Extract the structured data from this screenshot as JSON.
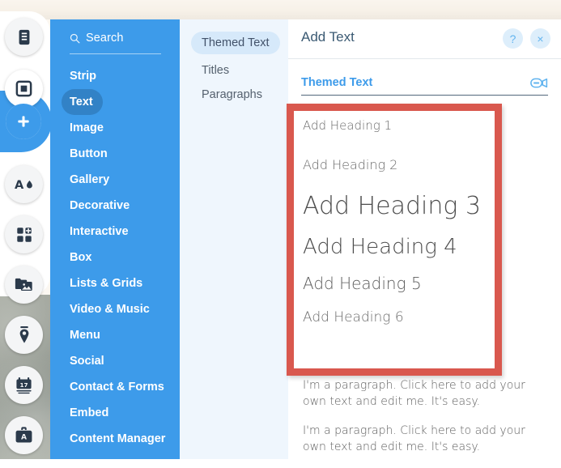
{
  "toolrail": {
    "items": [
      {
        "name": "pages-icon",
        "label": "Pages"
      },
      {
        "name": "background-icon",
        "label": "Background"
      },
      {
        "name": "add-icon",
        "label": "Add"
      },
      {
        "name": "design-icon",
        "label": "Design"
      },
      {
        "name": "apps-icon",
        "label": "Add Apps"
      },
      {
        "name": "media-icon",
        "label": "My Uploads"
      },
      {
        "name": "blog-icon",
        "label": "Blog"
      },
      {
        "name": "bookings-icon",
        "label": "Bookings"
      },
      {
        "name": "business-icon",
        "label": "Business Tools"
      }
    ]
  },
  "categories": {
    "search": {
      "placeholder": "Search",
      "value": "Search",
      "icon": "search-icon"
    },
    "items": [
      {
        "label": "Strip",
        "selected": false
      },
      {
        "label": "Text",
        "selected": true
      },
      {
        "label": "Image",
        "selected": false
      },
      {
        "label": "Button",
        "selected": false
      },
      {
        "label": "Gallery",
        "selected": false
      },
      {
        "label": "Decorative",
        "selected": false
      },
      {
        "label": "Interactive",
        "selected": false
      },
      {
        "label": "Box",
        "selected": false
      },
      {
        "label": "Lists & Grids",
        "selected": false
      },
      {
        "label": "Video & Music",
        "selected": false
      },
      {
        "label": "Menu",
        "selected": false
      },
      {
        "label": "Social",
        "selected": false
      },
      {
        "label": "Contact & Forms",
        "selected": false
      },
      {
        "label": "Embed",
        "selected": false
      },
      {
        "label": "Content Manager",
        "selected": false
      }
    ]
  },
  "subnav": {
    "items": [
      {
        "label": "Themed Text",
        "selected": true
      },
      {
        "label": "Titles",
        "selected": false
      },
      {
        "label": "Paragraphs",
        "selected": false
      }
    ]
  },
  "main": {
    "title": "Add Text",
    "help_label": "?",
    "close_label": "×",
    "section_title": "Themed Text",
    "video_icon": "video-camera-icon",
    "headings": [
      "Add Heading 1",
      "Add Heading 2",
      "Add Heading 3",
      "Add Heading 4",
      "Add Heading 5",
      "Add Heading 6"
    ],
    "paragraphs": [
      "I'm a paragraph. Click here to add your own text and edit me. It's easy.",
      "I'm a paragraph. Click here to add your own text and edit me. It's easy."
    ]
  },
  "colors": {
    "panel_blue": "#3d9bea",
    "panel_blue_selected": "#3282c6",
    "subpanel_bg": "#eff6fd",
    "subpanel_selected": "#d6e9fa",
    "accent_red": "#d9584e",
    "title_text": "#3b5a73",
    "section_blue": "#3d9bea"
  }
}
